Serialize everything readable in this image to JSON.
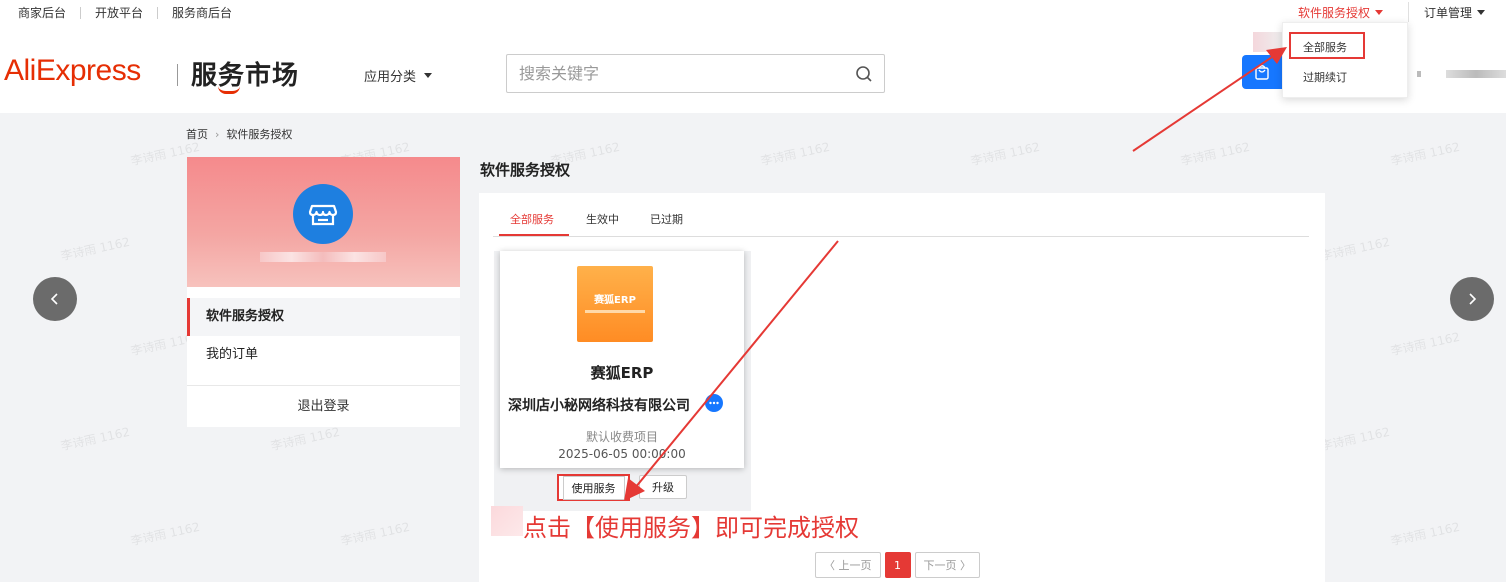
{
  "topbar": {
    "links": [
      "商家后台",
      "开放平台",
      "服务商后台"
    ],
    "auth_menu": "软件服务授权",
    "order_menu": "订单管理"
  },
  "header": {
    "logo_text": "AliExpress",
    "market_text": "服务市场",
    "category_label": "应用分类",
    "search_placeholder": "搜索关键字"
  },
  "dropdown": {
    "items": [
      "全部服务",
      "过期续订"
    ]
  },
  "breadcrumb": [
    "首页",
    "软件服务授权"
  ],
  "sidebar": {
    "items": [
      "软件服务授权",
      "我的订单"
    ],
    "logout": "退出登录"
  },
  "main": {
    "title": "软件服务授权",
    "tabs": [
      "全部服务",
      "生效中",
      "已过期"
    ],
    "card": {
      "logo_text": "赛狐ERP",
      "name": "赛狐ERP",
      "company": "深圳店小秘网络科技有限公司",
      "plan": "默认收费项目",
      "date": "2025-06-05 00:00:00",
      "use_button": "使用服务",
      "upgrade_button": "升级"
    },
    "instruction": "点击【使用服务】即可完成授权",
    "pager": {
      "prev": "上一页",
      "current": "1",
      "next": "下一页"
    }
  },
  "watermark_text": "李诗雨 1162",
  "colors": {
    "accent": "#e53935",
    "brand": "#e62e04",
    "blue": "#1677ff"
  }
}
